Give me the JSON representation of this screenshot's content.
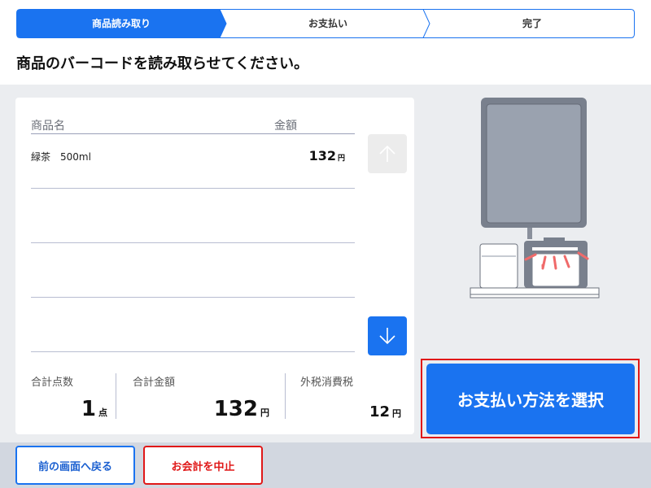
{
  "steps": [
    {
      "label": "商品読み取り",
      "active": true
    },
    {
      "label": "お支払い",
      "active": false
    },
    {
      "label": "完了",
      "active": false
    }
  ],
  "instruction": "商品のバーコードを読み取らせてください。",
  "list": {
    "headers": {
      "name": "商品名",
      "amount": "金額"
    },
    "items": [
      {
        "name": "緑茶　500ml",
        "price": "132",
        "unit": "円"
      }
    ]
  },
  "summary": {
    "count_label": "合計点数",
    "count_value": "1",
    "count_unit": "点",
    "total_label": "合計金額",
    "total_value": "132",
    "total_unit": "円",
    "tax_label": "外税消費税",
    "tax_value": "12",
    "tax_unit": "円"
  },
  "pay_button": "お支払い方法を選択",
  "footer": {
    "back_label": "前の画面へ戻る",
    "cancel_label": "お会計を中止"
  },
  "colors": {
    "accent": "#1a73f0",
    "danger": "#e01818"
  }
}
